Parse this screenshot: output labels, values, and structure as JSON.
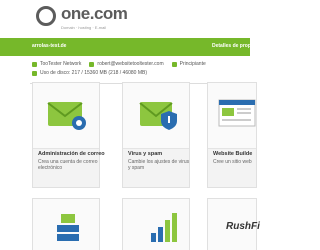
{
  "header": {
    "logo_text": "one.com",
    "logo_tagline": "Domain · hosting · E-mail"
  },
  "greenbar": {
    "domain": "arrolas-test.de",
    "right_label": "Detalles de propied"
  },
  "info": {
    "network": "TooTester Network",
    "email": "robert@websitetooltester.com",
    "role": "Principiante",
    "disk": "Uso de disco: 217 / 15360 MB (218 / 46080 MB)"
  },
  "cards": [
    {
      "title": "Administración de correo",
      "desc": "Crea una cuenta de correo electrónico"
    },
    {
      "title": "Virus y spam",
      "desc": "Cambie los ajustes de virus y spam"
    },
    {
      "title": "Website Builde",
      "desc": "Cree un sitio web"
    }
  ],
  "bottom": {
    "rush_label": "RushFi"
  },
  "colors": {
    "brand_green": "#76b82a",
    "logo_gray": "#5c5c5c"
  }
}
